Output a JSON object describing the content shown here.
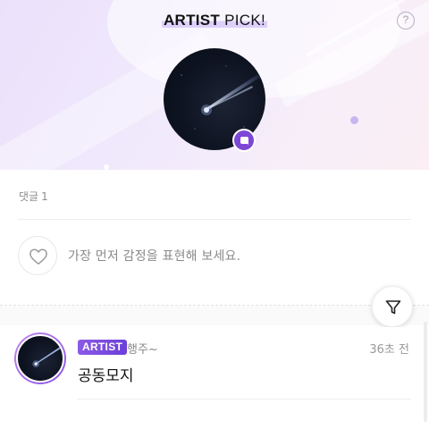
{
  "banner": {
    "title_bold": "ARTIST",
    "title_rest": " PICK!",
    "help_label": "?",
    "help_icon": "question-circle-icon",
    "avatar_icon": "shooting-star-avatar",
    "badge_icon": "chat-bubble-icon",
    "accent_color": "#7d47d6"
  },
  "comments": {
    "count_label": "댓글",
    "count": "1"
  },
  "emotion": {
    "icon": "heart-outline-icon",
    "prompt": "가장 먼저 감정을 표현해 보세요."
  },
  "filter": {
    "icon": "filter-funnel-icon"
  },
  "comment_list": [
    {
      "badge": "ARTIST",
      "author": "행주~",
      "time": "36초 전",
      "text": "공동모지",
      "badge_color": "#7b4ce0"
    }
  ]
}
